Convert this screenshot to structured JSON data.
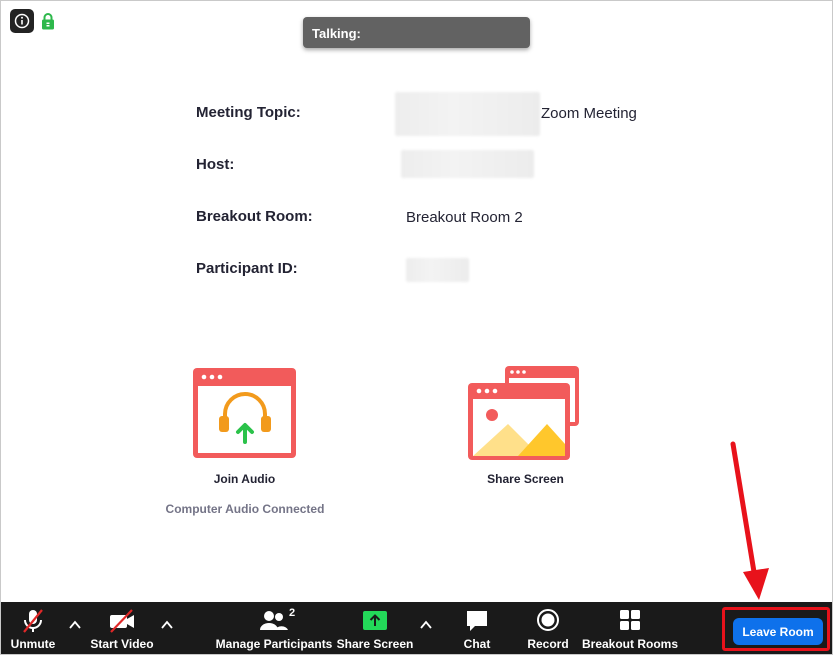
{
  "header": {
    "talking_label": "Talking:"
  },
  "meeting_info": {
    "topic_label": "Meeting Topic:",
    "topic_value": "Zoom Meeting",
    "host_label": "Host:",
    "breakout_label": "Breakout Room:",
    "breakout_value": "Breakout Room 2",
    "participant_label": "Participant ID:"
  },
  "actions": {
    "join_audio_label": "Join Audio",
    "join_audio_status": "Computer Audio Connected",
    "share_screen_label": "Share Screen"
  },
  "toolbar": {
    "unmute_label": "Unmute",
    "start_video_label": "Start Video",
    "participants_label": "Manage Participants",
    "participants_count": "2",
    "share_screen_label": "Share Screen",
    "chat_label": "Chat",
    "record_label": "Record",
    "breakout_label": "Breakout Rooms",
    "leave_label": "Leave Room"
  },
  "colors": {
    "toolbar_bg": "#1a1a1a",
    "leave_button": "#0e71eb",
    "highlight": "#e8121b",
    "card_red": "#f25b5b",
    "share_green": "#23d959",
    "headset_orange": "#f29a1c"
  },
  "icons": [
    "info-icon",
    "lock-icon",
    "headset-icon",
    "picture-icon",
    "microphone-muted-icon",
    "video-off-icon",
    "participants-icon",
    "share-screen-icon",
    "chat-icon",
    "record-icon",
    "breakout-rooms-icon",
    "caret-up-icon"
  ]
}
